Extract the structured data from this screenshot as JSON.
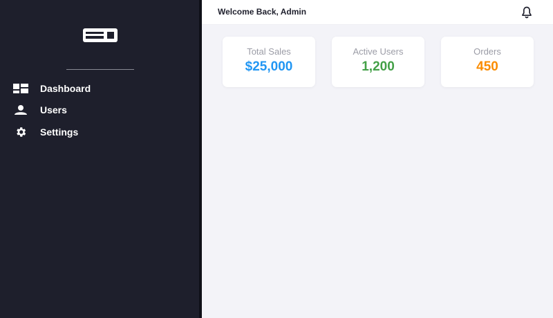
{
  "header": {
    "welcome_text": "Welcome Back, Admin",
    "notification_icon": "bell-icon"
  },
  "sidebar": {
    "logo_icon": "logo-icon",
    "items": [
      {
        "label": "Dashboard",
        "icon": "dashboard-icon"
      },
      {
        "label": "Users",
        "icon": "user-icon"
      },
      {
        "label": "Settings",
        "icon": "gear-icon"
      }
    ]
  },
  "stats": [
    {
      "label": "Total Sales",
      "value": "$25,000",
      "color": "#2196f3"
    },
    {
      "label": "Active Users",
      "value": "1,200",
      "color": "#43a047"
    },
    {
      "label": "Orders",
      "value": "450",
      "color": "#fb8c00"
    }
  ],
  "colors": {
    "sidebar_bg": "#1e1f2c",
    "main_bg": "#f3f3f8",
    "card_bg": "#ffffff"
  }
}
